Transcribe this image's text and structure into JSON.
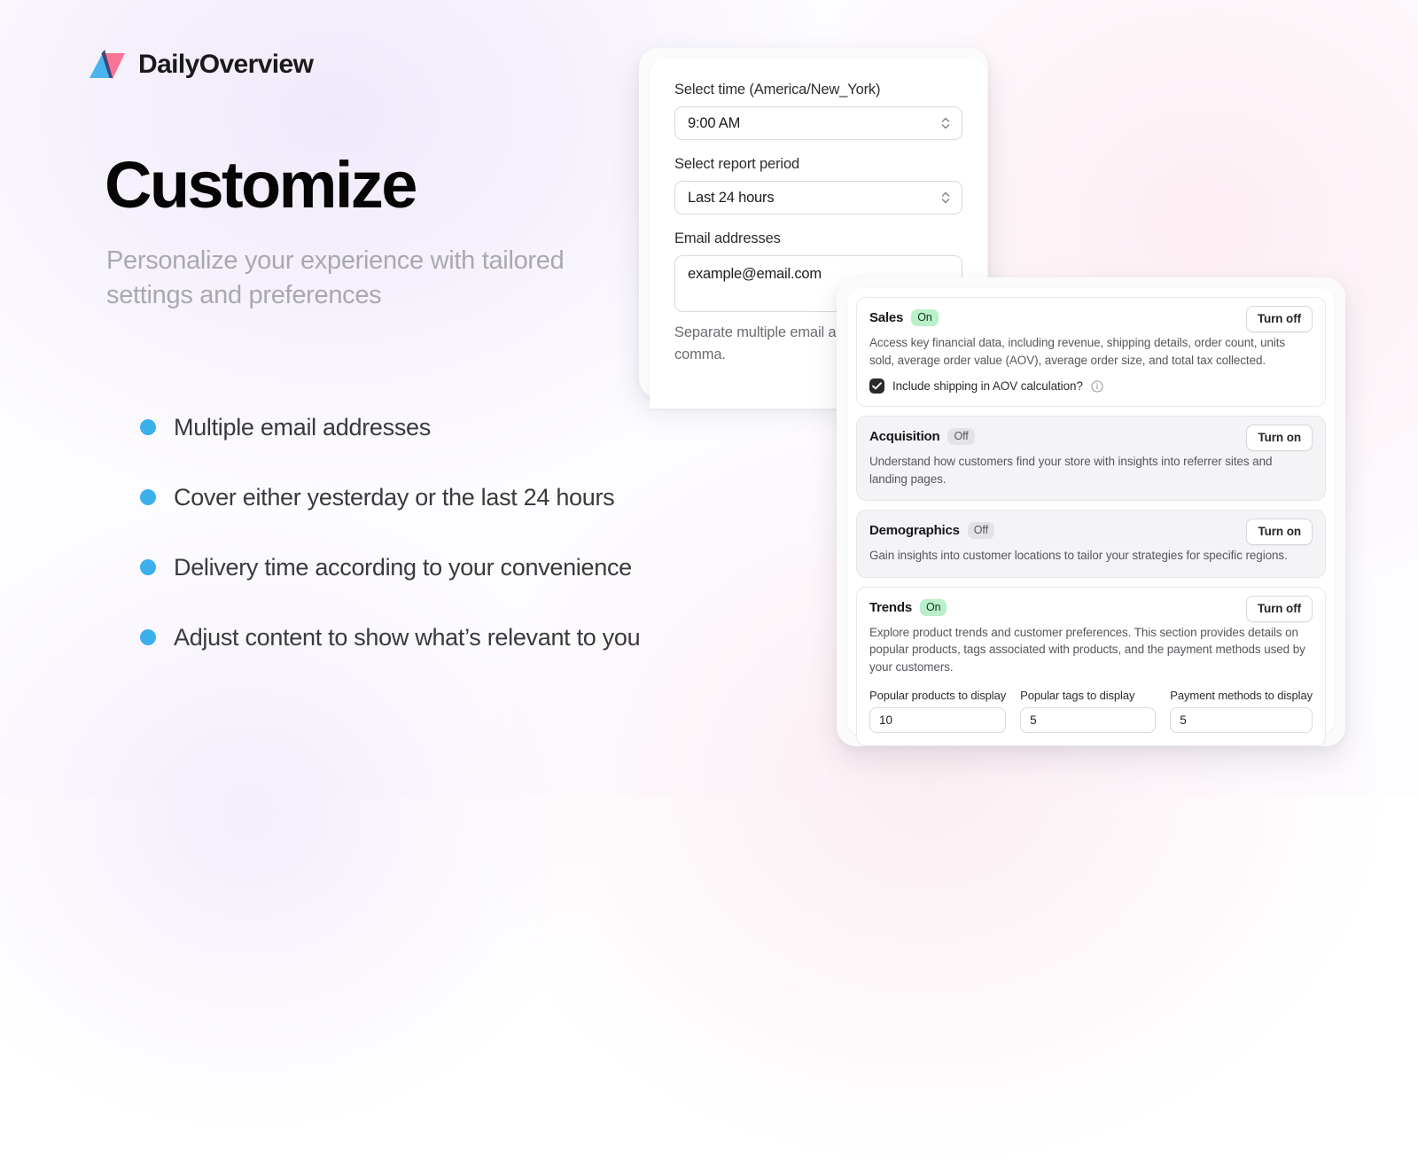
{
  "brand": {
    "name": "DailyOverview",
    "logo_icon": "dual-triangle-logo",
    "colors": {
      "blue": "#49b4ee",
      "pink": "#fb7496",
      "navy": "#3c4a7d"
    }
  },
  "hero": {
    "title": "Customize",
    "subtitle": "Personalize your experience with tailored settings and preferences",
    "bullet_color": "#3bb0ec",
    "features": [
      {
        "label": "Multiple email addresses"
      },
      {
        "label": "Cover either yesterday or the last 24 hours"
      },
      {
        "label": "Delivery time according to your convenience"
      },
      {
        "label": "Adjust content to show what’s relevant to you"
      }
    ]
  },
  "settings_card": {
    "time": {
      "label": "Select time (America/New_York)",
      "value": "9:00 AM",
      "stepper_icon": "chevron-up-down-icon"
    },
    "period": {
      "label": "Select report period",
      "value": "Last 24 hours",
      "stepper_icon": "chevron-up-down-icon"
    },
    "email": {
      "label": "Email addresses",
      "value": "example@email.com",
      "hint": "Separate multiple email addresses with a comma."
    }
  },
  "sections_card": {
    "sections": [
      {
        "title": "Sales",
        "state": "On",
        "state_key": "on",
        "button": "Turn off",
        "description": "Access key financial data, including revenue, shipping details, order count, units sold, average order value (AOV), average order size, and total tax collected.",
        "checkbox": {
          "label": "Include shipping in AOV calculation?",
          "checked": true,
          "info_icon": "info-circle-icon"
        }
      },
      {
        "title": "Acquisition",
        "state": "Off",
        "state_key": "off",
        "button": "Turn on",
        "description": "Understand how customers find your store with insights into referrer sites and landing pages."
      },
      {
        "title": "Demographics",
        "state": "Off",
        "state_key": "off",
        "button": "Turn on",
        "description": "Gain insights into customer locations to tailor your strategies for specific regions."
      },
      {
        "title": "Trends",
        "state": "On",
        "state_key": "on",
        "button": "Turn off",
        "description": "Explore product trends and customer preferences. This section provides details on popular products, tags associated with products, and the payment methods used by your customers.",
        "inputs": [
          {
            "label": "Popular products to display",
            "value": "10"
          },
          {
            "label": "Popular tags to display",
            "value": "5"
          },
          {
            "label": "Payment methods to display",
            "value": "5"
          }
        ]
      }
    ],
    "badge_colors": {
      "on_bg": "#b9f0c9",
      "off_bg": "#e3e3e7"
    }
  }
}
